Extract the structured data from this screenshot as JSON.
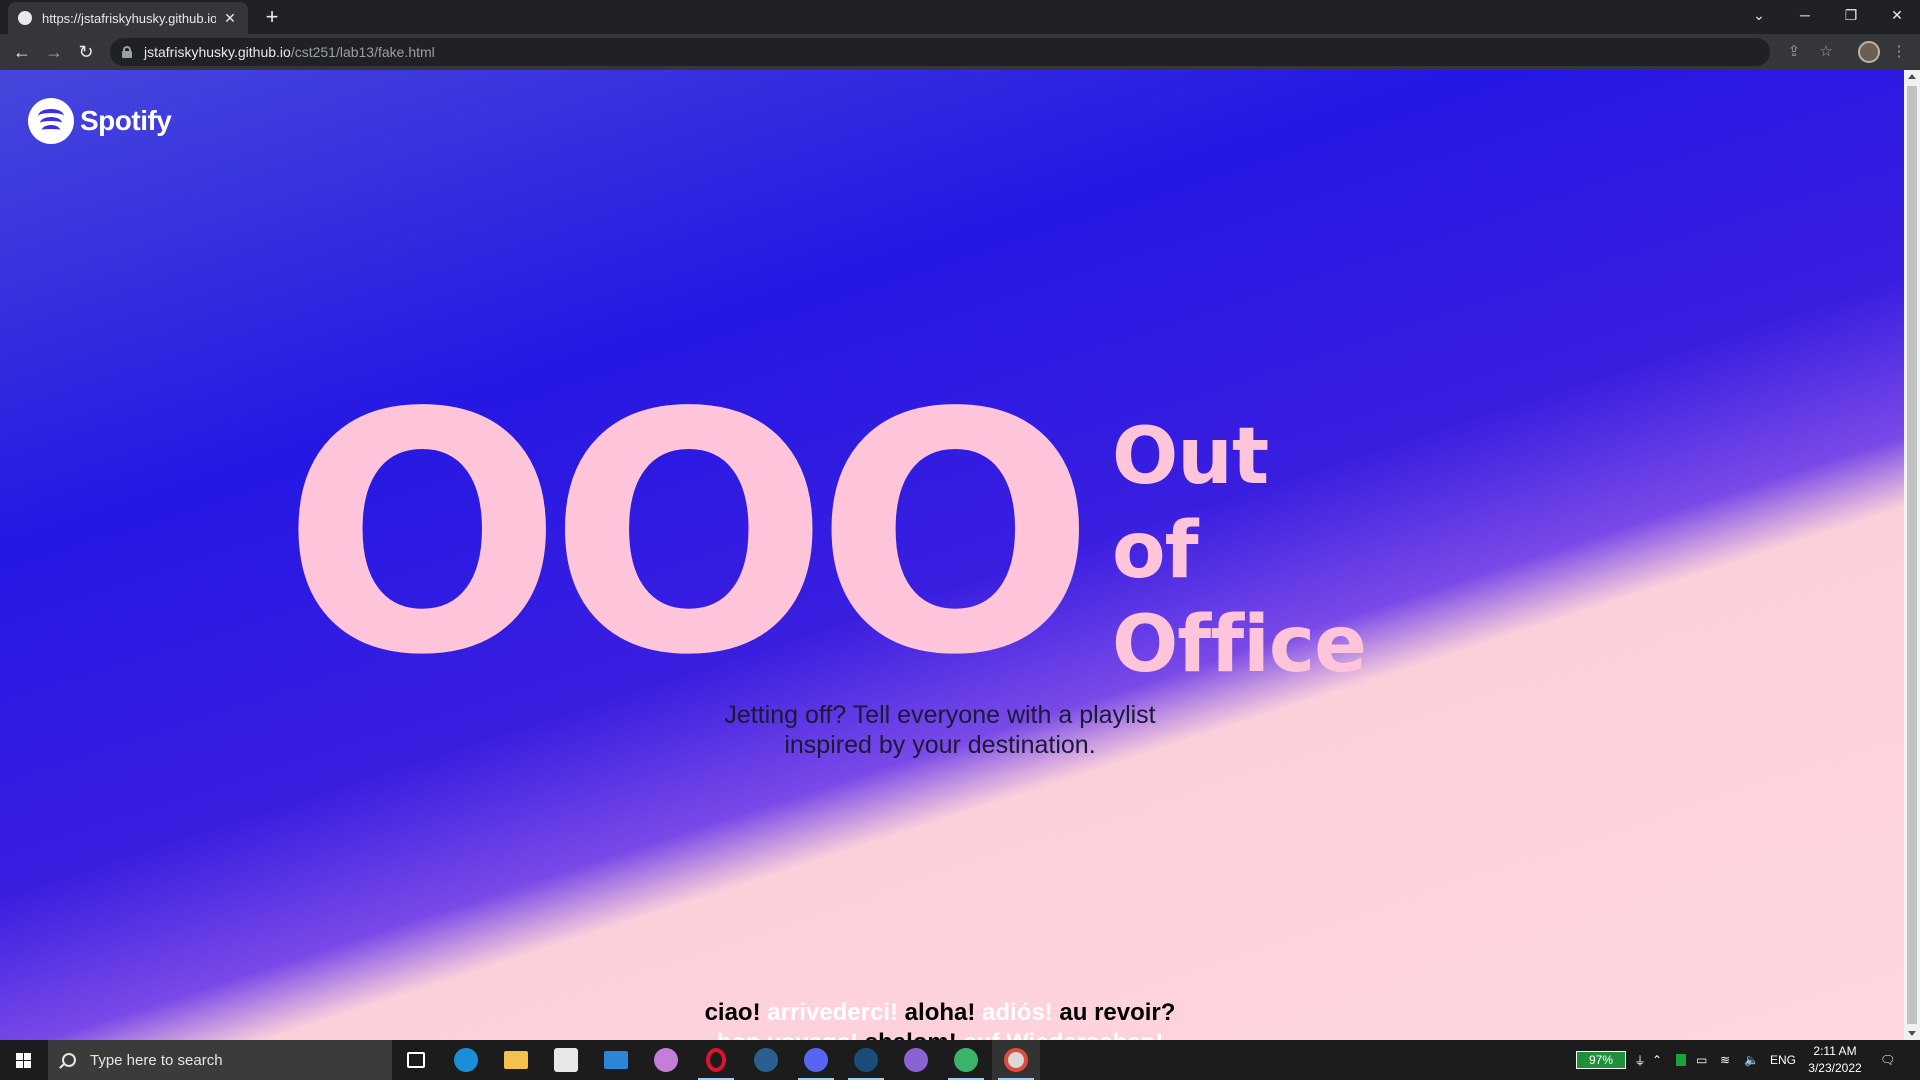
{
  "browser": {
    "tab_title": "https://jstafriskyhusky.github.io/c",
    "tab_close": "✕",
    "new_tab": "+",
    "url_host": "jstafriskyhusky.github.io",
    "url_path": "/cst251/lab13/fake.html",
    "icons": [
      "back-arrow-icon",
      "forward-arrow-icon",
      "reload-icon",
      "lock-icon",
      "share-icon",
      "star-icon",
      "profile-avatar",
      "menu-dots-icon"
    ]
  },
  "page": {
    "logo_text": "Spotify",
    "ooo": "OOO",
    "ooo_words": [
      "Out",
      "of",
      "Office"
    ],
    "tagline_line1": "Jetting off? Tell everyone with a playlist",
    "tagline_line2": "inspired by your destination.",
    "farewells_line1": [
      {
        "text": "ciao!",
        "tone": "dark"
      },
      {
        "text": "arrivederci!",
        "tone": "light"
      },
      {
        "text": "aloha!",
        "tone": "dark"
      },
      {
        "text": "adiós!",
        "tone": "light"
      },
      {
        "text": "au revoir?",
        "tone": "dark"
      }
    ],
    "farewells_line2": [
      {
        "text": "bon voyage!",
        "tone": "light"
      },
      {
        "text": "shalom!",
        "tone": "dark"
      },
      {
        "text": "auf Wiedersehen!",
        "tone": "light"
      }
    ],
    "colors": {
      "gradient_blue": "#2518e3",
      "gradient_pink": "#ffd6de",
      "ooo_pink": "#fec4d9"
    }
  },
  "taskbar": {
    "search_placeholder": "Type here to search",
    "battery": "97%",
    "language": "ENG",
    "time": "2:11 AM",
    "date": "3/23/2022"
  }
}
